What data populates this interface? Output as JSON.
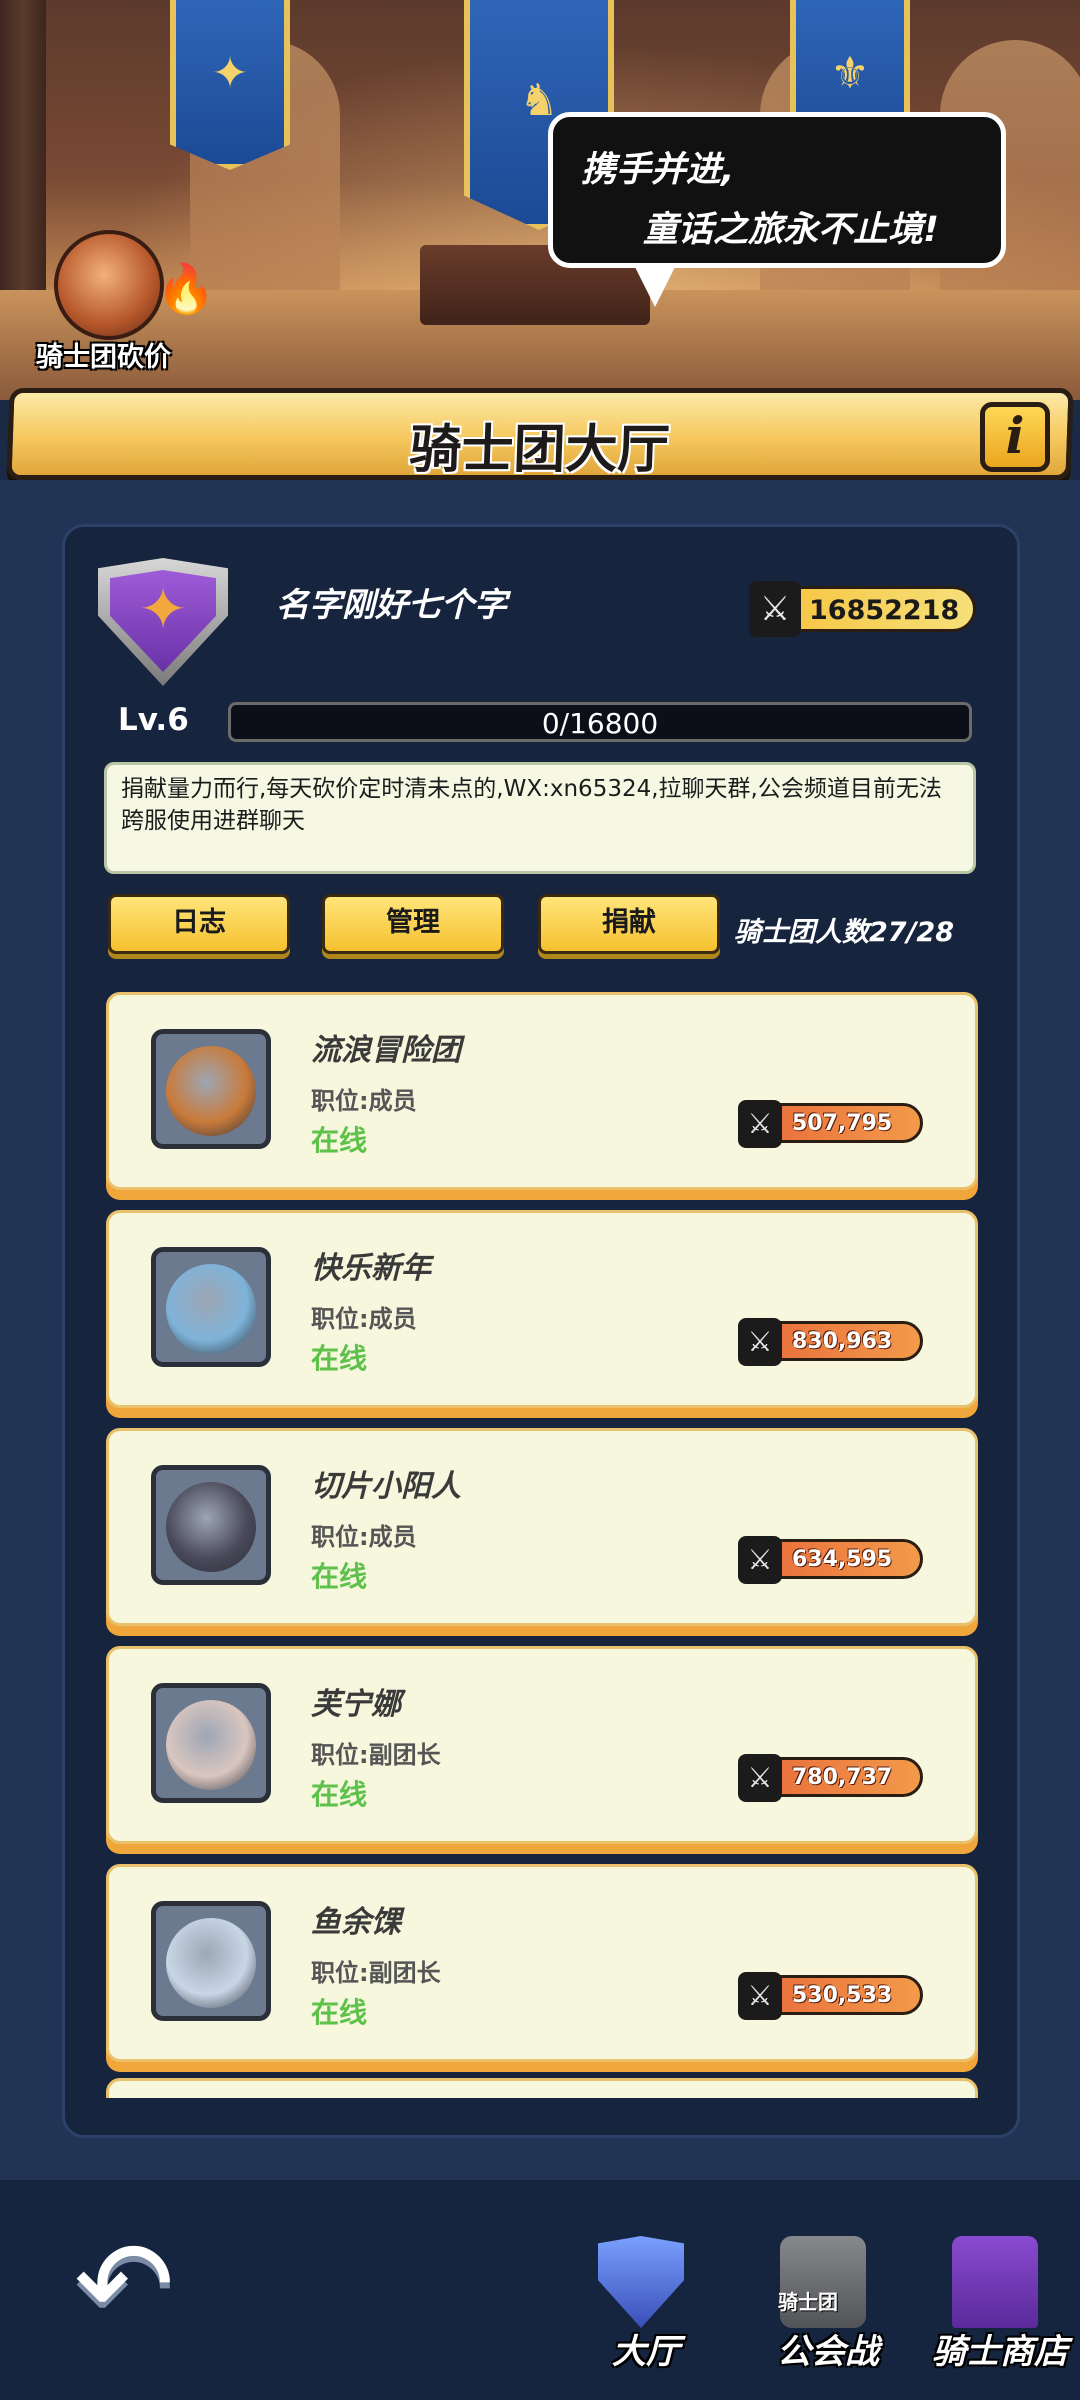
{
  "hero": {
    "speech_line1": "携手并进,",
    "speech_line2": "童话之旅永不止境!",
    "bargain_label": "骑士团砍价"
  },
  "header": {
    "title": "骑士团大厅",
    "info_label": "i"
  },
  "guild": {
    "name": "名字刚好七个字",
    "power": "16852218",
    "level": "Lv.6",
    "exp_text": "0/16800",
    "exp_fraction": 0,
    "notice": "捐献量力而行,每天砍价定时清未点的,WX:xn65324,拉聊天群,公会频道目前无法跨服使用进群聊天",
    "member_count": "骑士团人数27/28"
  },
  "tabs": {
    "log": "日志",
    "manage": "管理",
    "donate": "捐献"
  },
  "members": [
    {
      "name": "流浪冒险团",
      "role": "职位:成员",
      "status": "在线",
      "power": "507,795",
      "avatar_color": "#c97a3a"
    },
    {
      "name": "快乐新年",
      "role": "职位:成员",
      "status": "在线",
      "power": "830,963",
      "avatar_color": "#7fb3d9"
    },
    {
      "name": "切片小阳人",
      "role": "职位:成员",
      "status": "在线",
      "power": "634,595",
      "avatar_color": "#4a4a5a"
    },
    {
      "name": "芙宁娜",
      "role": "职位:副团长",
      "status": "在线",
      "power": "780,737",
      "avatar_color": "#d9c6c0"
    },
    {
      "name": "鱼余馃",
      "role": "职位:副团长",
      "status": "在线",
      "power": "530,533",
      "avatar_color": "#c9d6e6"
    }
  ],
  "nav": {
    "back": "↶",
    "hall": "大厅",
    "war_sub": "骑士团",
    "war": "公会战",
    "shop": "骑士商店"
  },
  "icons": [
    "fleur-de-lis-icon",
    "compass-star-icon",
    "crossed-swords-icon",
    "info-icon",
    "back-arrow-icon",
    "shield-icon",
    "shop-icon"
  ],
  "colors": {
    "accent_yellow": "#f6c12f",
    "online_green": "#5dc14a",
    "panel_bg": "#16243d",
    "page_bg": "#213456",
    "card_bg": "#f7f7de"
  }
}
